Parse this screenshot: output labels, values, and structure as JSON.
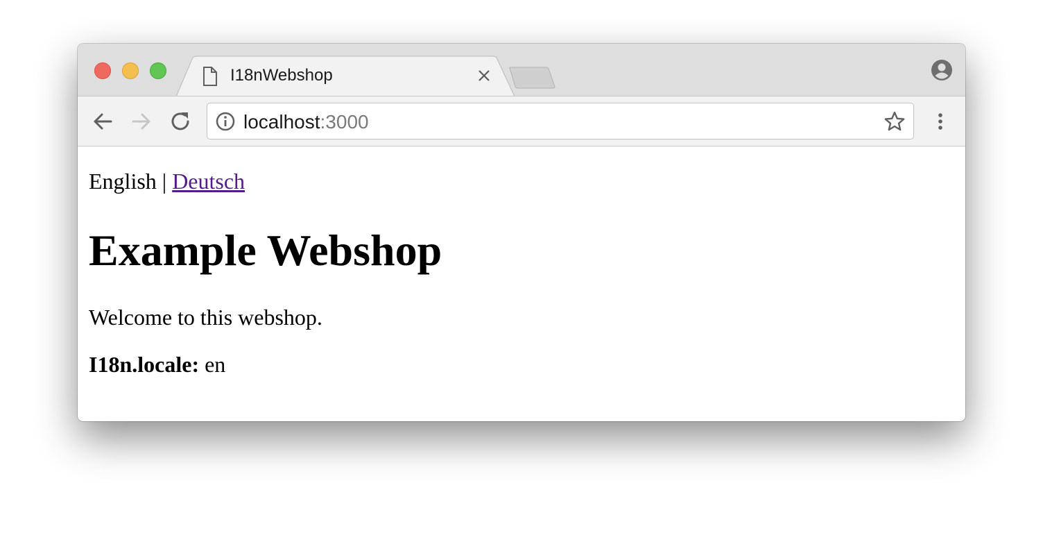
{
  "browser": {
    "tab": {
      "title": "I18nWebshop"
    },
    "address": {
      "host": "localhost",
      "port": ":3000"
    }
  },
  "page": {
    "language_switcher": {
      "current": "English",
      "separator": " | ",
      "alternate": "Deutsch"
    },
    "title": "Example Webshop",
    "welcome": "Welcome to this webshop.",
    "locale": {
      "label": "I18n.locale:",
      "value": " en"
    }
  },
  "colors": {
    "link_visited": "#551a8b",
    "close": "#ee6a5f",
    "minimize": "#f5bf4f",
    "maximize": "#62c655"
  },
  "icons": [
    "page-icon",
    "close-icon",
    "profile-icon",
    "back-arrow-icon",
    "forward-arrow-icon",
    "reload-icon",
    "info-icon",
    "star-icon",
    "kebab-menu-icon"
  ]
}
